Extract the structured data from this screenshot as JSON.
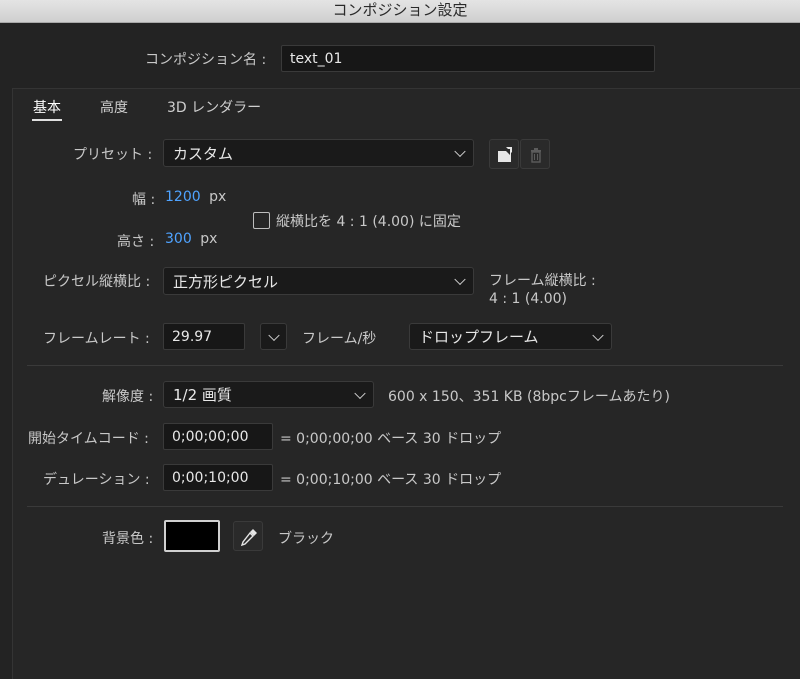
{
  "window": {
    "title": "コンポジション設定"
  },
  "comp_name": {
    "label": "コンポジション名 :",
    "value": "text_01"
  },
  "tabs": [
    {
      "label": "基本",
      "active": true
    },
    {
      "label": "高度",
      "active": false
    },
    {
      "label": "3D レンダラー",
      "active": false
    }
  ],
  "preset": {
    "label": "プリセット :",
    "value": "カスタム",
    "save_icon": "save-preset-icon",
    "delete_icon": "trash-icon"
  },
  "width": {
    "label": "幅 :",
    "value": "1200",
    "unit": "px"
  },
  "height": {
    "label": "高さ :",
    "value": "300",
    "unit": "px"
  },
  "lock_aspect": {
    "label": "縦横比を 4 : 1 (4.00) に固定",
    "checked": false
  },
  "pixel_aspect": {
    "label": "ピクセル縦横比 :",
    "value": "正方形ピクセル"
  },
  "frame_aspect": {
    "label": "フレーム縦横比 :",
    "value": "4 : 1 (4.00)"
  },
  "frame_rate": {
    "label": "フレームレート :",
    "value": "29.97",
    "unit_label": "フレーム/秒",
    "drop_value": "ドロップフレーム"
  },
  "resolution": {
    "label": "解像度 :",
    "value": "1/2 画質",
    "info": "600 x 150、351 KB (8bpcフレームあたり)"
  },
  "start_timecode": {
    "label": "開始タイムコード :",
    "value": "0;00;00;00",
    "info": "= 0;00;00;00  ベース 30  ドロップ"
  },
  "duration": {
    "label": "デュレーション :",
    "value": "0;00;10;00",
    "info": "= 0;00;10;00  ベース 30  ドロップ"
  },
  "background": {
    "label": "背景色 :",
    "color": "#000000",
    "color_name": "ブラック",
    "eyedropper_icon": "eyedropper-icon"
  },
  "colors": {
    "accent_blue": "#4fa3ff",
    "background": "#232323"
  }
}
